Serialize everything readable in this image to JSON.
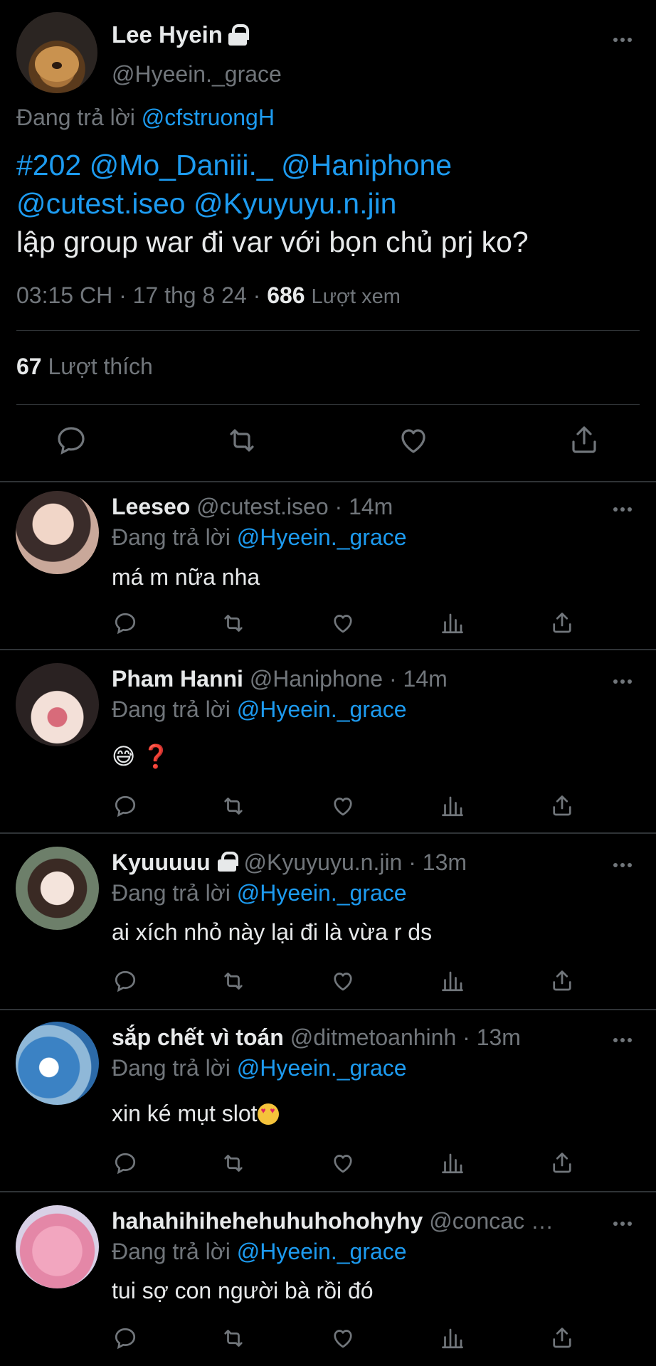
{
  "main_tweet": {
    "name": "Lee Hyein",
    "handle": "@Hyeein._grace",
    "replying_prefix": "Đang trả lời",
    "replying_to": "@cfstruongH",
    "text_mentions_line1": "#202 @Mo_Daniii._ @Haniphone",
    "text_mentions_line2": "@cutest.iseo @Kyuyuyu.n.jin",
    "text_body": "lập group war đi var với bọn chủ prj ko?",
    "time": "03:15 CH · 17 thg 8 24 · ",
    "views_count": "686",
    "views_label": "Lượt xem",
    "likes_count": "67",
    "likes_label": "Lượt thích",
    "icons": [
      "reply-icon",
      "retweet-icon",
      "like-icon",
      "share-icon"
    ]
  },
  "replies": [
    {
      "name": "Leeseo",
      "handle": "@cutest.iseo",
      "time": "· 14m",
      "replying_prefix": "Đang trả lời",
      "replying_to": "@Hyeein._grace",
      "text": "má m nữa nha",
      "locked": false
    },
    {
      "name": "Pham Hanni",
      "handle": "@Haniphone",
      "time": "· 14m",
      "replying_prefix": "Đang trả lời",
      "replying_to": "@Hyeein._grace",
      "text": "😅 ❓",
      "locked": false
    },
    {
      "name": "Kyuuuuu",
      "handle": "@Kyuyuyu.n.jin",
      "time": "· 13m",
      "replying_prefix": "Đang trả lời",
      "replying_to": "@Hyeein._grace",
      "text": "ai xích nhỏ này lại đi là vừa r ds",
      "locked": true
    },
    {
      "name": "sắp chết vì toán",
      "handle": "@ditmetoanhinh",
      "time": "· 13m",
      "replying_prefix": "Đang trả lời",
      "replying_to": "@Hyeein._grace",
      "text": "xin ké mụt slot",
      "locked": false
    },
    {
      "name": "hahahihihehehuhuhohohyhy",
      "handle": "@concac …",
      "time": "",
      "replying_prefix": "Đang trả lời",
      "replying_to": "@Hyeein._grace",
      "text": "tui sợ con người bà rồi đó",
      "locked": false
    }
  ],
  "reply_action_icons": [
    "reply-icon",
    "retweet-icon",
    "like-icon",
    "views-icon",
    "share-icon"
  ],
  "colors": {
    "background": "#000000",
    "text": "#e7e9ea",
    "secondary": "#71767b",
    "accent": "#1d9bf0",
    "divider": "#2f3336"
  }
}
